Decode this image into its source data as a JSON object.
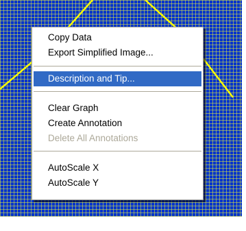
{
  "graph": {
    "background_color": "#0033cc",
    "grid_color": "#ebeb3c",
    "curve_color": "#ffff00"
  },
  "context_menu": {
    "highlight_color": "#316ac5",
    "disabled_color": "#aca899",
    "items": [
      {
        "label": "Copy Data",
        "enabled": true,
        "highlighted": false
      },
      {
        "label": "Export Simplified Image...",
        "enabled": true,
        "highlighted": false
      },
      {
        "label": "Description and Tip...",
        "enabled": true,
        "highlighted": true
      },
      {
        "label": "Clear Graph",
        "enabled": true,
        "highlighted": false
      },
      {
        "label": "Create Annotation",
        "enabled": true,
        "highlighted": false
      },
      {
        "label": "Delete All Annotations",
        "enabled": false,
        "highlighted": false
      },
      {
        "label": "AutoScale X",
        "enabled": true,
        "highlighted": false
      },
      {
        "label": "AutoScale Y",
        "enabled": true,
        "highlighted": false
      }
    ]
  }
}
